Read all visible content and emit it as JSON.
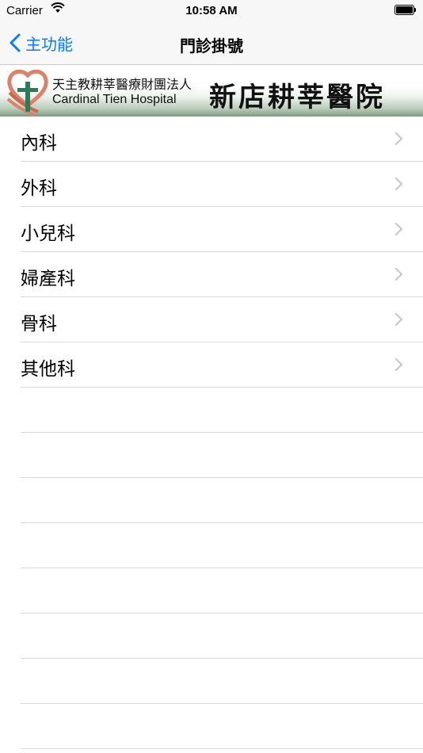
{
  "status_bar": {
    "carrier": "Carrier",
    "time": "10:58 AM"
  },
  "nav": {
    "back_label": "主功能",
    "title": "門診掛號"
  },
  "banner": {
    "org_name": "天主教耕莘醫療財團法人",
    "english_name": "Cardinal Tien Hospital",
    "hospital_name": "新店耕莘醫院"
  },
  "departments": [
    {
      "label": "內科"
    },
    {
      "label": "外科"
    },
    {
      "label": "小兒科"
    },
    {
      "label": "婦產科"
    },
    {
      "label": "骨科"
    },
    {
      "label": "其他科"
    }
  ],
  "colors": {
    "accent": "#0a7aff",
    "separator": "#d9d9dd",
    "chevron": "#c7c7cc"
  }
}
